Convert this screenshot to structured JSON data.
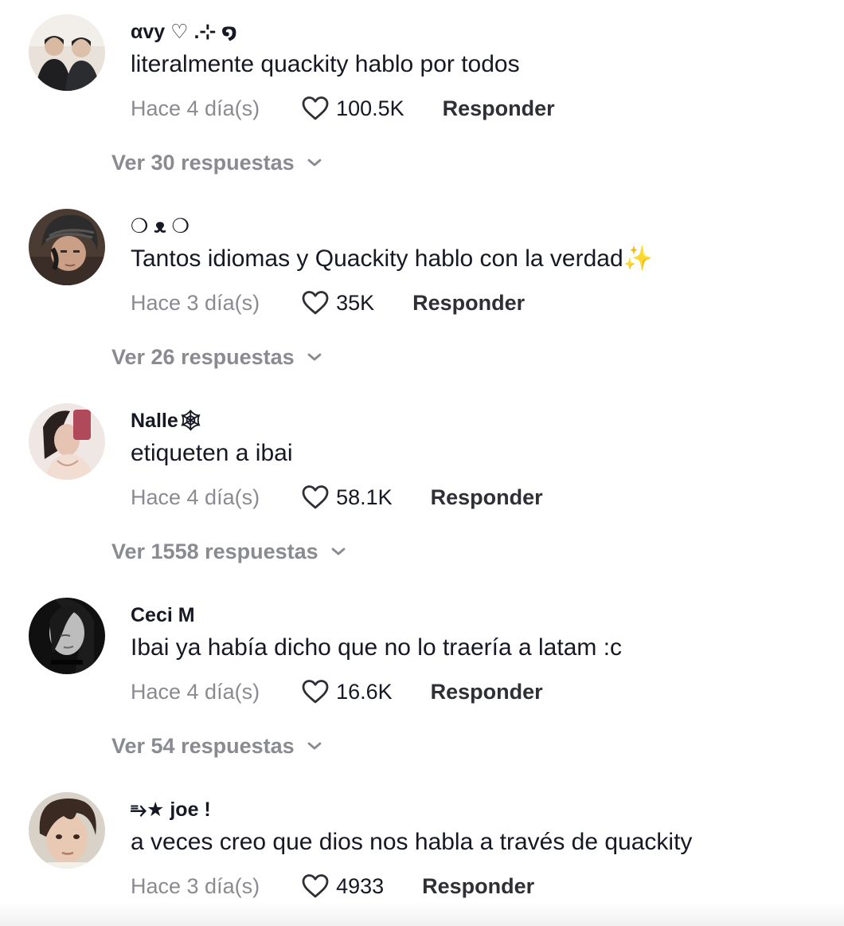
{
  "comments": [
    {
      "username": "αvy ♡︎ .⊹ ໑",
      "text": "literalmente quackity hablo por todos",
      "time": "Hace 4 día(s)",
      "likes": "100.5K",
      "reply_label": "Responder",
      "view_replies": "Ver 30 respuestas",
      "avatar_icon": "avatar-two-people-photo"
    },
    {
      "username": "❍ ᴥ ❍",
      "text": "Tantos idiomas y Quackity hablo con la verdad✨",
      "time": "Hace 3 día(s)",
      "likes": "35K",
      "reply_label": "Responder",
      "view_replies": "Ver 26 respuestas",
      "avatar_icon": "avatar-beanie-photo"
    },
    {
      "username": "Nalle🕸",
      "text": "etiqueten a ibai",
      "time": "Hace 4 día(s)",
      "likes": "58.1K",
      "reply_label": "Responder",
      "view_replies": "Ver 1558 respuestas",
      "avatar_icon": "avatar-selfie-photo"
    },
    {
      "username": "Ceci M",
      "text": "Ibai ya había dicho que no lo traería a latam :c",
      "time": "Hace 4 día(s)",
      "likes": "16.6K",
      "reply_label": "Responder",
      "view_replies": "Ver 54 respuestas",
      "avatar_icon": "avatar-bw-portrait-photo"
    },
    {
      "username": "⥱★ joe !",
      "text": "a veces creo que dios nos habla a través de quackity",
      "time": "Hace 3 día(s)",
      "likes": "4933",
      "reply_label": "Responder",
      "avatar_icon": "avatar-portrait-photo"
    }
  ],
  "colors": {
    "text_primary": "#161823",
    "text_secondary": "#8a8b91",
    "background": "#ffffff"
  },
  "icons": {
    "like": "heart-outline-icon",
    "expand": "chevron-down-icon"
  }
}
